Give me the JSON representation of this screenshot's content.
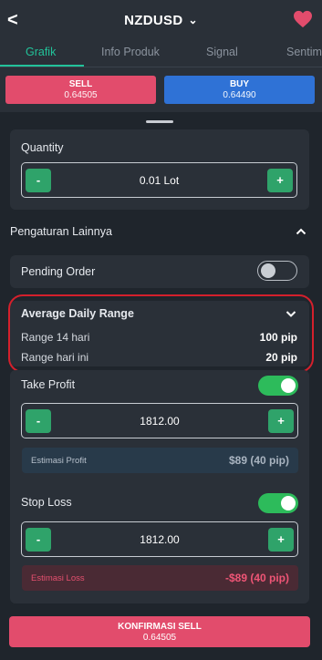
{
  "header": {
    "back_label": "<",
    "symbol": "NZDUSD",
    "dropdown_chevron": "chevron-down-icon",
    "favorite_icon": "heart-icon",
    "favorite_color": "#e24c6c"
  },
  "tabs": [
    {
      "label": "Grafik",
      "active": true
    },
    {
      "label": "Info Produk",
      "active": false
    },
    {
      "label": "Signal",
      "active": false
    },
    {
      "label": "Sentim",
      "active": false
    }
  ],
  "trade": {
    "sell": {
      "label": "SELL",
      "price": "0.64505",
      "color": "#e24c6c"
    },
    "buy": {
      "label": "BUY",
      "price": "0.64490",
      "color": "#2f72d6"
    }
  },
  "quantity": {
    "label": "Quantity",
    "minus": "-",
    "plus": "+",
    "value": "0.01 Lot"
  },
  "settings": {
    "title": "Pengaturan Lainnya",
    "pending_order": {
      "label": "Pending Order",
      "enabled": false
    }
  },
  "adr": {
    "title": "Average Daily Range",
    "rows": [
      {
        "label": "Range 14 hari",
        "value": "100 pip"
      },
      {
        "label": "Range hari ini",
        "value": "20 pip"
      }
    ]
  },
  "take_profit": {
    "label": "Take Profit",
    "enabled": true,
    "minus": "-",
    "plus": "+",
    "value": "1812.00",
    "estimate_label": "Estimasi Profit",
    "estimate_value": "$89 (40 pip)"
  },
  "stop_loss": {
    "label": "Stop Loss",
    "enabled": true,
    "minus": "-",
    "plus": "+",
    "value": "1812.00",
    "estimate_label": "Estimasi Loss",
    "estimate_value": "-$89 (40 pip)"
  },
  "confirm": {
    "label": "KONFIRMASI SELL",
    "price": "0.64505"
  },
  "colors": {
    "accent_green": "#22c39a",
    "toggle_on": "#2dbb5b",
    "highlight_outline": "#d4202c"
  }
}
